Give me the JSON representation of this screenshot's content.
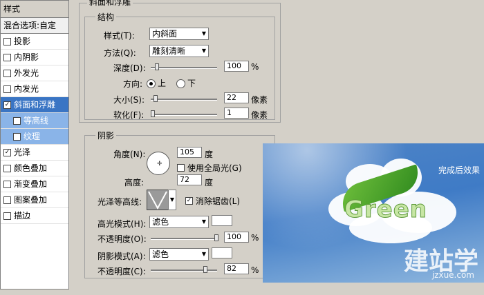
{
  "panel": {
    "header": "样式",
    "blend": "混合选项:自定",
    "items": [
      {
        "label": "投影",
        "checked": false
      },
      {
        "label": "内阴影",
        "checked": false
      },
      {
        "label": "外发光",
        "checked": false
      },
      {
        "label": "内发光",
        "checked": false
      },
      {
        "label": "斜面和浮雕",
        "checked": true
      },
      {
        "label": "等高线",
        "checked": false
      },
      {
        "label": "纹理",
        "checked": false
      },
      {
        "label": "光泽",
        "checked": true
      },
      {
        "label": "颜色叠加",
        "checked": false
      },
      {
        "label": "渐变叠加",
        "checked": false
      },
      {
        "label": "图案叠加",
        "checked": false
      },
      {
        "label": "描边",
        "checked": false
      }
    ]
  },
  "bevel": {
    "section_title": "斜面和浮雕",
    "structure_title": "结构",
    "style_label": "样式(T):",
    "style_value": "内斜面",
    "method_label": "方法(Q):",
    "method_value": "雕刻清晰",
    "depth_label": "深度(D):",
    "depth_value": "100",
    "depth_unit": "%",
    "direction_label": "方向:",
    "dir_up": "上",
    "dir_down": "下",
    "size_label": "大小(S):",
    "size_value": "22",
    "size_unit": "像素",
    "soften_label": "软化(F):",
    "soften_value": "1",
    "soften_unit": "像素"
  },
  "shading": {
    "title": "阴影",
    "angle_label": "角度(N):",
    "angle_value": "105",
    "angle_unit": "度",
    "global_light": "使用全局光(G)",
    "altitude_label": "高度:",
    "altitude_value": "72",
    "altitude_unit": "度",
    "gloss_label": "光泽等高线:",
    "antialias": "消除锯齿(L)",
    "highlight_label": "高光模式(H):",
    "highlight_mode": "滤色",
    "highlight_opacity_label": "不透明度(O):",
    "highlight_opacity": "100",
    "shadow_label": "阴影模式(A):",
    "shadow_mode": "滤色",
    "shadow_opacity_label": "不透明度(C):",
    "shadow_opacity": "82",
    "pct": "%"
  },
  "preview": {
    "caption": "完成后效果",
    "word": "Green",
    "watermark": "建站学",
    "watermark_url": "jzxue.com"
  }
}
